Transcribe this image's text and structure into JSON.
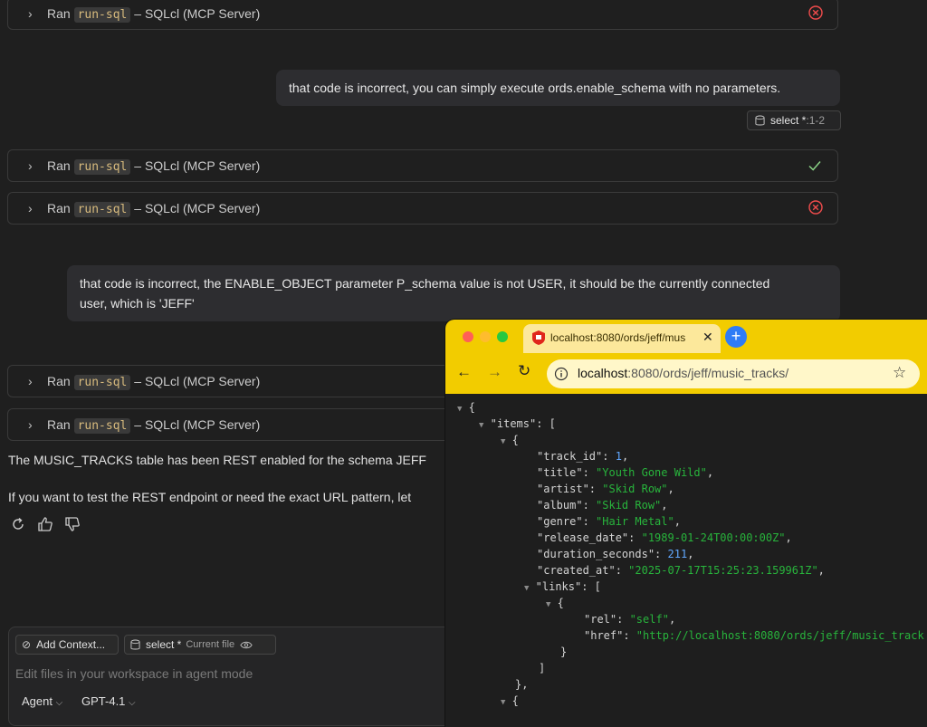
{
  "tool_runs": {
    "prefix": "Ran",
    "tool": "run-sql",
    "suffix": "– SQLcl (MCP Server)"
  },
  "messages": {
    "user_1": "that code is incorrect, you can simply execute ords.enable_schema with no parameters.",
    "user_1_ref": {
      "name": "select *",
      "range": ":1-2"
    },
    "user_2_line1": "that code is incorrect, the ENABLE_OBJECT parameter P_schema value is not USER, it should be the currently connected",
    "user_2_line2": "user, which is 'JEFF'",
    "agent_1": "The MUSIC_TRACKS table has been REST enabled for the schema JEFF",
    "agent_2": "If you want to test the REST endpoint or need the exact URL pattern, let"
  },
  "input": {
    "add_context": "Add Context...",
    "file_name": "select *",
    "file_label": "Current file",
    "placeholder": "Edit files in your workspace in agent mode",
    "mode": "Agent",
    "model": "GPT-4.1"
  },
  "browser": {
    "tab_title": "localhost:8080/ords/jeff/mus",
    "url_host": "localhost",
    "url_path": ":8080/ords/jeff/music_tracks/",
    "json": {
      "open_brace": "{",
      "items_key": "\"items\"",
      "track_id": "1",
      "title": "\"Youth Gone Wild\"",
      "artist": "\"Skid Row\"",
      "album": "\"Skid Row\"",
      "genre": "\"Hair Metal\"",
      "release_date": "\"1989-01-24T00:00:00Z\"",
      "duration_seconds": "211",
      "created_at": "\"2025-07-17T15:25:23.159961Z\"",
      "rel": "\"self\"",
      "href": "\"http://localhost:8080/ords/jeff/music_track"
    }
  },
  "colors": {
    "error": "#f14c4c",
    "success": "#89d185",
    "browser_theme": "#f2cc00"
  }
}
